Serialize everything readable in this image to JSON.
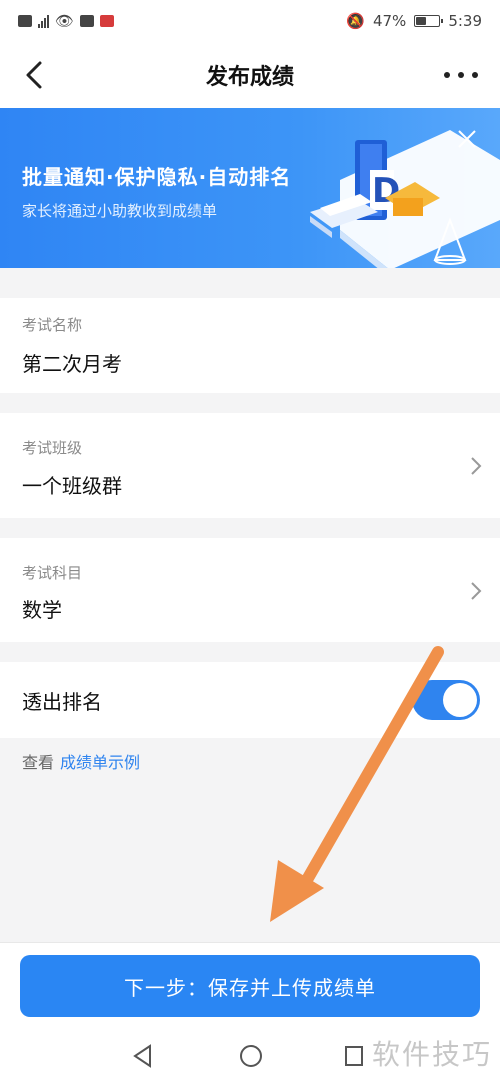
{
  "status_bar": {
    "battery_percent": "47%",
    "time": "5:39",
    "battery_level": 0.47
  },
  "nav": {
    "title": "发布成绩"
  },
  "banner": {
    "title": "批量通知·保护隐私·自动排名",
    "subtitle": "家长将通过小助教收到成绩单"
  },
  "exam_name": {
    "label": "考试名称",
    "value": "第二次月考"
  },
  "exam_class": {
    "label": "考试班级",
    "value": "一个班级群"
  },
  "exam_subject": {
    "label": "考试科目",
    "value": "数学"
  },
  "ranking": {
    "label": "透出排名",
    "enabled": true
  },
  "sample": {
    "prefix": "查看",
    "link": "成绩单示例"
  },
  "submit": {
    "label": "下一步：保存并上传成绩单"
  },
  "watermark": {
    "text": "软件技巧"
  },
  "colors": {
    "accent": "#2a86f3",
    "banner": "#3d95f7",
    "annotation_arrow": "#f0904a"
  }
}
